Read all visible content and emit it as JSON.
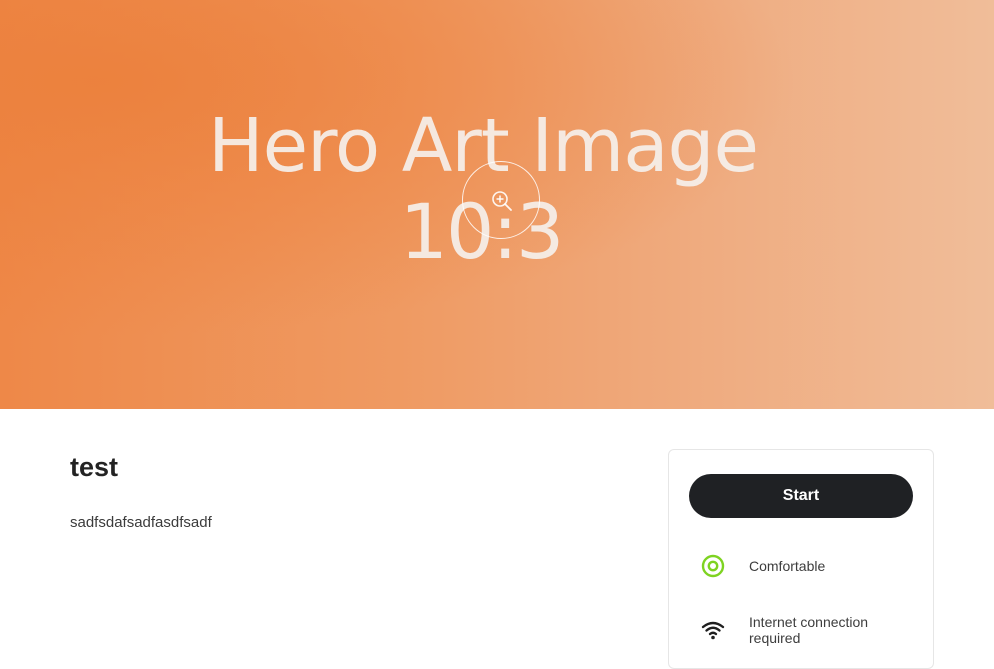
{
  "hero": {
    "line1": "Hero Art Image",
    "line2": "10:3",
    "zoom_icon": "zoom-in-icon"
  },
  "content": {
    "title": "test",
    "description": "sadfsdafsadfasdfsadf"
  },
  "card": {
    "start_label": "Start",
    "features": [
      {
        "icon": "target-circle-icon",
        "label": "Comfortable",
        "color": "#7ed321"
      },
      {
        "icon": "wifi-icon",
        "label": "Internet connection required",
        "color": "#1f1f1f"
      }
    ]
  },
  "colors": {
    "accent_button": "#1f2124",
    "hero_orange": "#ee8848",
    "comfort_green": "#7ed321"
  }
}
